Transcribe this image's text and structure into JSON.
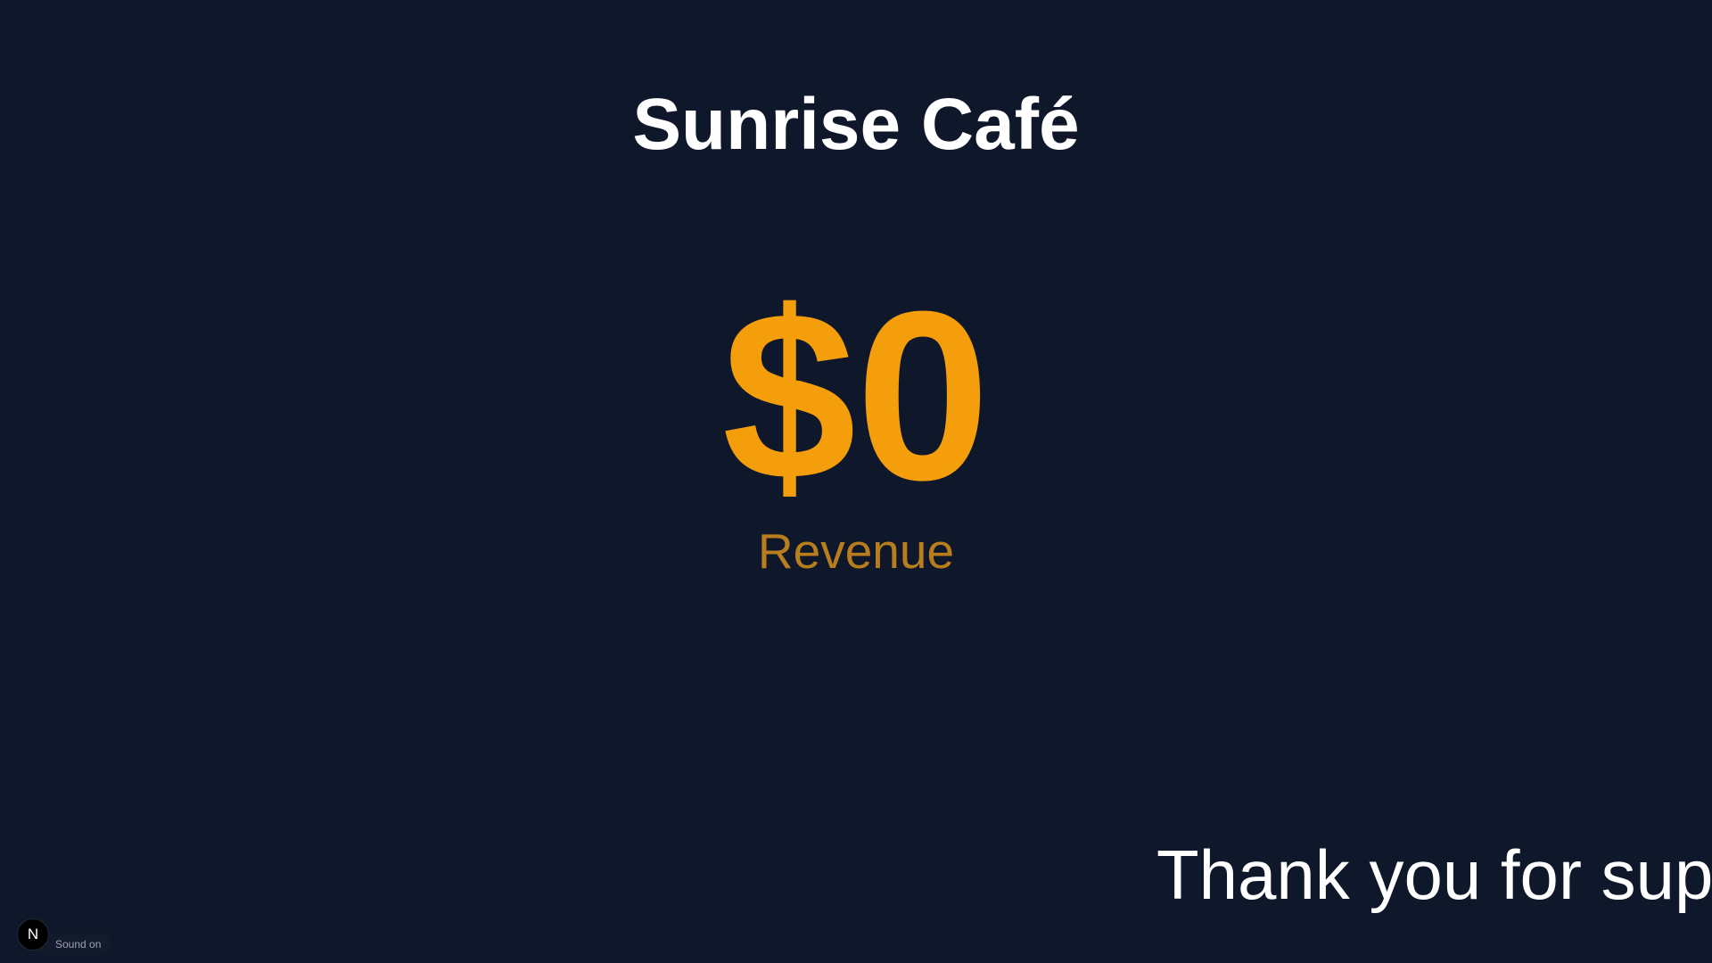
{
  "header": {
    "title": "Sunrise Café"
  },
  "metric": {
    "value": "$0",
    "label": "Revenue"
  },
  "ticker": {
    "text": "Thank you for supp"
  },
  "dev_overlay": {
    "logo_letter": "N",
    "sound_label": "Sound on"
  },
  "colors": {
    "background": "#0f172a",
    "title": "#ffffff",
    "accent": "#f59e0b",
    "label": "#b87e1e"
  }
}
